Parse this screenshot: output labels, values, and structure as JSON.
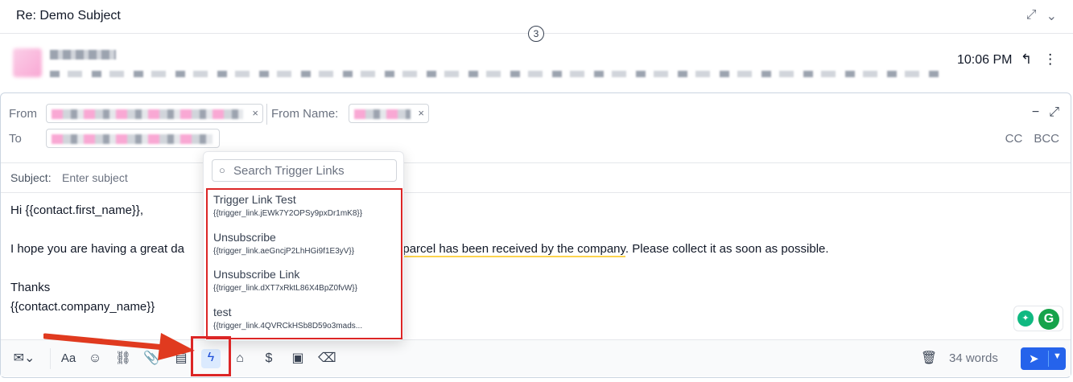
{
  "header": {
    "subject": "Re: Demo Subject",
    "thread_count": "3"
  },
  "message": {
    "time": "10:06 PM"
  },
  "composer": {
    "from_label": "From",
    "from_name_label": "From Name:",
    "to_label": "To",
    "cc_label": "CC",
    "bcc_label": "BCC",
    "subject_label": "Subject:",
    "subject_placeholder": "Enter subject",
    "body": {
      "greeting": "Hi {{contact.first_name}},",
      "para_start": "I hope you are having a great da",
      "para_highlight": "your parcel has been received by the company",
      "para_end": ". Please collect it as soon as possible.",
      "closing": "Thanks",
      "signature": "{{contact.company_name}}"
    }
  },
  "trigger_dropdown": {
    "search_placeholder": "Search Trigger Links",
    "items": [
      {
        "name": "Trigger Link Test",
        "code": "{{trigger_link.jEWk7Y2OPSy9pxDr1mK8}}"
      },
      {
        "name": "Unsubscribe",
        "code": "{{trigger_link.aeGncjP2LhHGi9f1E3yV}}"
      },
      {
        "name": "Unsubscribe Link",
        "code": "{{trigger_link.dXT7xRktL86X4BpZ0fvW}}"
      },
      {
        "name": "test",
        "code": "{{trigger_link.4QVRCkHSb8D59o3mads..."
      }
    ]
  },
  "toolbar": {
    "word_count": "34 words"
  },
  "colors": {
    "accent": "#2563eb",
    "highlight_annotation": "#dc2626"
  }
}
